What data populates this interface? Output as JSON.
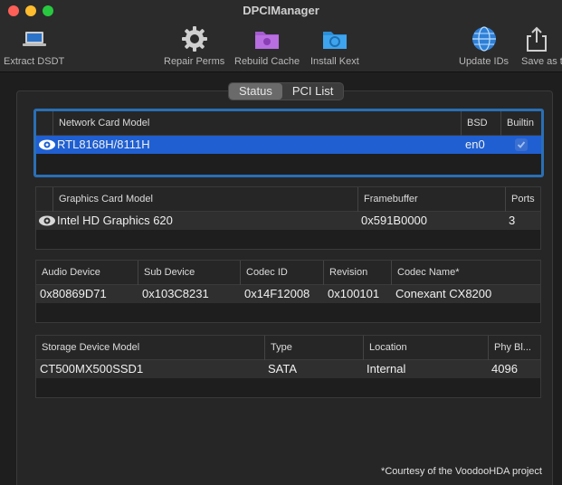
{
  "window": {
    "title": "DPCIManager"
  },
  "toolbar": {
    "extract": "Extract DSDT",
    "repair": "Repair Perms",
    "rebuild": "Rebuild Cache",
    "install": "Install Kext",
    "update": "Update IDs",
    "save": "Save as t"
  },
  "tabs": {
    "status": "Status",
    "pci": "PCI List"
  },
  "network": {
    "headers": {
      "model": "Network Card Model",
      "bsd": "BSD",
      "builtin": "Builtin"
    },
    "row": {
      "model": "RTL8168H/8111H",
      "bsd": "en0",
      "builtin": true
    }
  },
  "graphics": {
    "headers": {
      "model": "Graphics Card Model",
      "framebuffer": "Framebuffer",
      "ports": "Ports"
    },
    "row": {
      "model": "Intel HD Graphics 620",
      "framebuffer": "0x591B0000",
      "ports": "3"
    }
  },
  "audio": {
    "headers": {
      "device": "Audio Device",
      "sub": "Sub Device",
      "codec": "Codec ID",
      "rev": "Revision",
      "name": "Codec Name*"
    },
    "row": {
      "device": "0x80869D71",
      "sub": "0x103C8231",
      "codec": "0x14F12008",
      "rev": "0x100101",
      "name": "Conexant CX8200"
    }
  },
  "storage": {
    "headers": {
      "model": "Storage Device Model",
      "type": "Type",
      "location": "Location",
      "phy": "Phy Bl..."
    },
    "row": {
      "model": "CT500MX500SSD1",
      "type": "SATA",
      "location": "Internal",
      "phy": "4096"
    }
  },
  "footnote": "*Courtesy of the VoodooHDA project",
  "colors": {
    "accent": "#1f5fd1",
    "focus": "#2a6fb5"
  }
}
